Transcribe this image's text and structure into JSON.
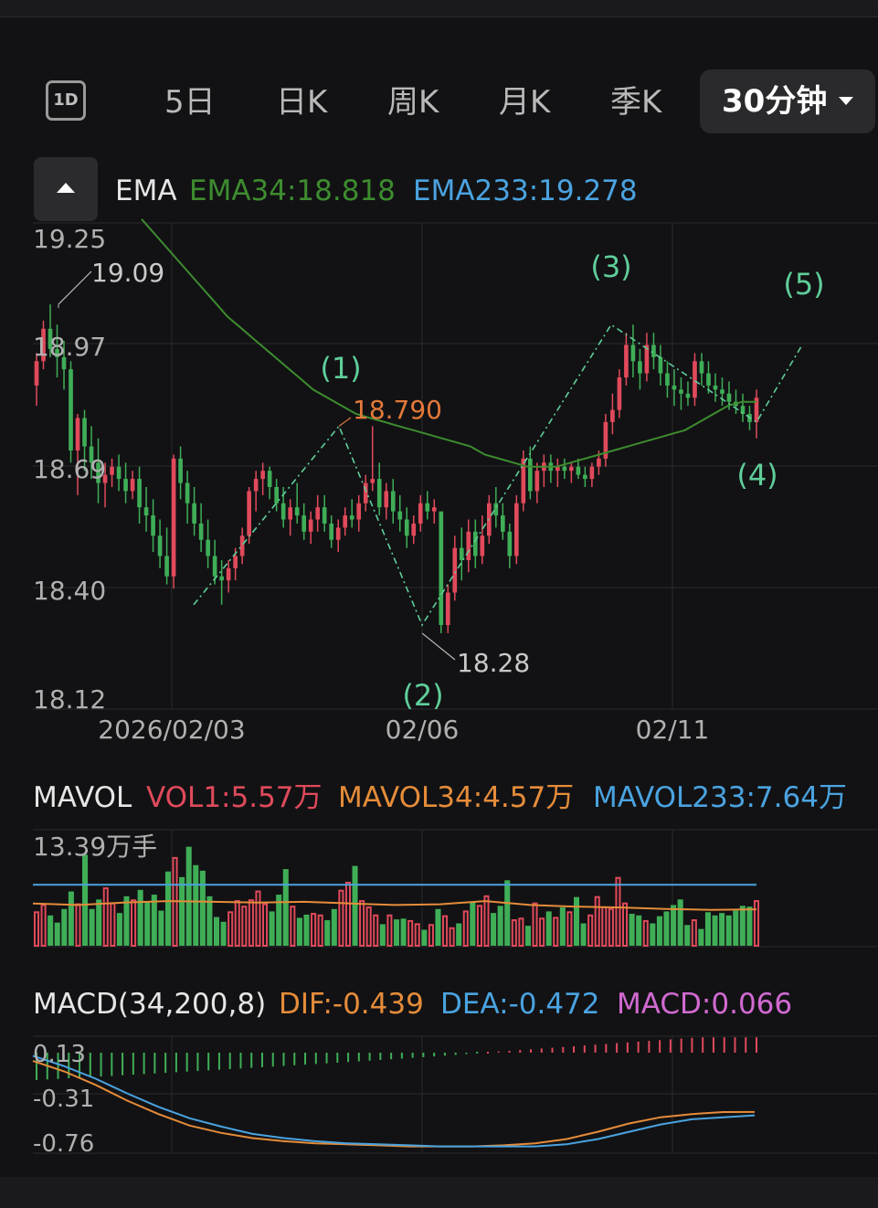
{
  "tabs": [
    {
      "label": "1D"
    },
    {
      "label": "5日"
    },
    {
      "label": "日K"
    },
    {
      "label": "周K"
    },
    {
      "label": "月K"
    },
    {
      "label": "季K"
    }
  ],
  "active_tab": {
    "label": "30分钟"
  },
  "ema_legend": {
    "name": "EMA",
    "ema34": "EMA34:18.818",
    "ema233": "EMA233:19.278"
  },
  "vol_legend": {
    "name": "MAVOL",
    "vol1": "VOL1:5.57万",
    "mavol34": "MAVOL34:4.57万",
    "mavol233": "MAVOL233:7.64万"
  },
  "macd_legend": {
    "name": "MACD(34,200,8)",
    "dif": "DIF:-0.439",
    "dea": "DEA:-0.472",
    "macd": "MACD:0.066"
  },
  "colors": {
    "up": "#e04a5b",
    "down": "#3fae57",
    "ema34": "#3d8c2f",
    "ema233": "#4aa3e0",
    "wave": "#5fcf9a",
    "high_label": "#e3793a",
    "mavol34": "#e58c3a",
    "mavol233": "#4aa3e0",
    "macd_hist": "#d26ad2"
  },
  "chart_data": [
    {
      "type": "candlestick",
      "ylim": [
        18.12,
        19.25
      ],
      "y_ticks": [
        "19.25",
        "18.97",
        "18.69",
        "18.40",
        "18.12"
      ],
      "x_ticks": [
        "2026/02/03",
        "02/06",
        "02/11"
      ],
      "ohlc": [
        [
          18.89,
          18.97,
          18.84,
          18.95
        ],
        [
          18.95,
          19.05,
          18.93,
          19.03
        ],
        [
          19.03,
          19.09,
          18.96,
          18.98
        ],
        [
          18.98,
          19.04,
          18.91,
          18.96
        ],
        [
          18.96,
          19.0,
          18.88,
          18.93
        ],
        [
          18.93,
          18.95,
          18.7,
          18.73
        ],
        [
          18.73,
          18.82,
          18.62,
          18.81
        ],
        [
          18.81,
          18.83,
          18.68,
          18.74
        ],
        [
          18.74,
          18.79,
          18.66,
          18.7
        ],
        [
          18.7,
          18.76,
          18.6,
          18.65
        ],
        [
          18.65,
          18.7,
          18.59,
          18.67
        ],
        [
          18.67,
          18.71,
          18.64,
          18.69
        ],
        [
          18.69,
          18.72,
          18.63,
          18.66
        ],
        [
          18.66,
          18.7,
          18.6,
          18.63
        ],
        [
          18.63,
          18.68,
          18.61,
          18.66
        ],
        [
          18.66,
          18.69,
          18.55,
          18.59
        ],
        [
          18.59,
          18.64,
          18.53,
          18.57
        ],
        [
          18.57,
          18.61,
          18.48,
          18.52
        ],
        [
          18.52,
          18.56,
          18.44,
          18.47
        ],
        [
          18.47,
          18.54,
          18.4,
          18.42
        ],
        [
          18.42,
          18.72,
          18.39,
          18.71
        ],
        [
          18.71,
          18.74,
          18.61,
          18.65
        ],
        [
          18.65,
          18.68,
          18.55,
          18.6
        ],
        [
          18.6,
          18.64,
          18.52,
          18.55
        ],
        [
          18.55,
          18.6,
          18.48,
          18.51
        ],
        [
          18.51,
          18.56,
          18.44,
          18.47
        ],
        [
          18.47,
          18.51,
          18.4,
          18.42
        ],
        [
          18.42,
          18.46,
          18.35,
          18.41
        ],
        [
          18.41,
          18.46,
          18.38,
          18.44
        ],
        [
          18.44,
          18.49,
          18.41,
          18.47
        ],
        [
          18.47,
          18.54,
          18.45,
          18.52
        ],
        [
          18.52,
          18.64,
          18.5,
          18.63
        ],
        [
          18.63,
          18.68,
          18.58,
          18.66
        ],
        [
          18.66,
          18.7,
          18.62,
          18.68
        ],
        [
          18.68,
          18.69,
          18.61,
          18.64
        ],
        [
          18.64,
          18.66,
          18.58,
          18.6
        ],
        [
          18.6,
          18.64,
          18.54,
          18.56
        ],
        [
          18.56,
          18.61,
          18.52,
          18.59
        ],
        [
          18.59,
          18.65,
          18.55,
          18.57
        ],
        [
          18.57,
          18.6,
          18.51,
          18.53
        ],
        [
          18.53,
          18.58,
          18.5,
          18.56
        ],
        [
          18.56,
          18.62,
          18.53,
          18.59
        ],
        [
          18.59,
          18.62,
          18.53,
          18.55
        ],
        [
          18.55,
          18.57,
          18.49,
          18.51
        ],
        [
          18.51,
          18.56,
          18.48,
          18.54
        ],
        [
          18.54,
          18.59,
          18.52,
          18.57
        ],
        [
          18.57,
          18.61,
          18.54,
          18.56
        ],
        [
          18.56,
          18.62,
          18.53,
          18.6
        ],
        [
          18.6,
          18.67,
          18.58,
          18.65
        ],
        [
          18.65,
          18.79,
          18.63,
          18.66
        ],
        [
          18.66,
          18.7,
          18.57,
          18.59
        ],
        [
          18.59,
          18.65,
          18.56,
          18.63
        ],
        [
          18.63,
          18.66,
          18.55,
          18.58
        ],
        [
          18.58,
          18.62,
          18.53,
          18.56
        ],
        [
          18.56,
          18.59,
          18.49,
          18.52
        ],
        [
          18.52,
          18.57,
          18.5,
          18.55
        ],
        [
          18.55,
          18.62,
          18.53,
          18.6
        ],
        [
          18.6,
          18.63,
          18.56,
          18.58
        ],
        [
          18.58,
          18.61,
          18.55,
          18.59
        ],
        [
          18.58,
          18.56,
          18.28,
          18.3
        ],
        [
          18.3,
          18.4,
          18.28,
          18.38
        ],
        [
          18.38,
          18.52,
          18.36,
          18.49
        ],
        [
          18.49,
          18.54,
          18.41,
          18.46
        ],
        [
          18.46,
          18.56,
          18.43,
          18.53
        ],
        [
          18.53,
          18.56,
          18.44,
          18.47
        ],
        [
          18.47,
          18.57,
          18.45,
          18.52
        ],
        [
          18.52,
          18.62,
          18.5,
          18.6
        ],
        [
          18.6,
          18.64,
          18.54,
          18.57
        ],
        [
          18.57,
          18.6,
          18.51,
          18.53
        ],
        [
          18.53,
          18.55,
          18.44,
          18.47
        ],
        [
          18.47,
          18.62,
          18.45,
          18.6
        ],
        [
          18.6,
          18.73,
          18.58,
          18.71
        ],
        [
          18.71,
          18.74,
          18.61,
          18.63
        ],
        [
          18.63,
          18.7,
          18.6,
          18.68
        ],
        [
          18.68,
          18.72,
          18.64,
          18.7
        ],
        [
          18.7,
          18.72,
          18.65,
          18.68
        ],
        [
          18.68,
          18.71,
          18.64,
          18.69
        ],
        [
          18.69,
          18.71,
          18.66,
          18.68
        ],
        [
          18.68,
          18.7,
          18.65,
          18.69
        ],
        [
          18.69,
          18.71,
          18.66,
          18.67
        ],
        [
          18.67,
          18.69,
          18.64,
          18.66
        ],
        [
          18.66,
          18.7,
          18.64,
          18.69
        ],
        [
          18.69,
          18.73,
          18.67,
          18.71
        ],
        [
          18.71,
          18.82,
          18.69,
          18.8
        ],
        [
          18.8,
          18.87,
          18.77,
          18.83
        ],
        [
          18.83,
          18.93,
          18.81,
          18.91
        ],
        [
          18.91,
          19.02,
          18.89,
          18.99
        ],
        [
          18.99,
          19.04,
          18.91,
          18.95
        ],
        [
          18.95,
          18.98,
          18.88,
          18.92
        ],
        [
          18.92,
          19.02,
          18.9,
          18.99
        ],
        [
          18.99,
          19.02,
          18.93,
          18.96
        ],
        [
          18.96,
          18.99,
          18.89,
          18.92
        ],
        [
          18.92,
          18.95,
          18.86,
          18.89
        ],
        [
          18.89,
          18.93,
          18.84,
          18.88
        ],
        [
          18.88,
          18.91,
          18.83,
          18.87
        ],
        [
          18.87,
          18.9,
          18.84,
          18.86
        ],
        [
          18.86,
          18.97,
          18.84,
          18.95
        ],
        [
          18.95,
          18.97,
          18.89,
          18.92
        ],
        [
          18.92,
          18.95,
          18.87,
          18.89
        ],
        [
          18.89,
          18.92,
          18.85,
          18.88
        ],
        [
          18.88,
          18.91,
          18.84,
          18.87
        ],
        [
          18.87,
          18.9,
          18.83,
          18.85
        ],
        [
          18.85,
          18.88,
          18.82,
          18.84
        ],
        [
          18.84,
          18.87,
          18.8,
          18.82
        ],
        [
          18.82,
          18.84,
          18.78,
          18.8
        ],
        [
          18.8,
          18.88,
          18.76,
          18.86
        ]
      ],
      "ema34": [
        19.3,
        19.26,
        19.22,
        19.18,
        19.14,
        19.1,
        19.06,
        19.03,
        19.0,
        18.97,
        18.94,
        18.91,
        18.88,
        18.86,
        18.84,
        18.82,
        18.81,
        18.8,
        18.79,
        18.78,
        18.77,
        18.76,
        18.75,
        18.74,
        18.72,
        18.71,
        18.7,
        18.69,
        18.69,
        18.69,
        18.7,
        18.71,
        18.72,
        18.73,
        18.74,
        18.75,
        18.76,
        18.77,
        18.78,
        18.8,
        18.82,
        18.84,
        18.85,
        18.85
      ],
      "annotations": [
        {
          "text": "19.09",
          "value": 19.09,
          "kind": "high"
        },
        {
          "text": "18.790",
          "value": 18.79,
          "kind": "wave-high"
        },
        {
          "text": "18.28",
          "value": 18.28,
          "kind": "low"
        }
      ],
      "wave_labels": [
        "(1)",
        "(2)",
        "(3)",
        "(4)",
        "(5)"
      ],
      "wave_points": [
        18.35,
        18.79,
        18.3,
        19.04,
        18.8,
        18.99
      ]
    },
    {
      "type": "bar",
      "title": "MAVOL",
      "ymax_label": "13.39万手",
      "volumes": [
        4.2,
        5.1,
        3.8,
        2.9,
        4.6,
        6.8,
        5.2,
        11.4,
        4.6,
        5.8,
        7.2,
        5.3,
        4.1,
        6.2,
        5.7,
        7.0,
        5.6,
        6.4,
        4.4,
        9.3,
        11.0,
        8.6,
        12.4,
        10.1,
        9.4,
        6.2,
        3.6,
        3.0,
        4.2,
        5.6,
        4.9,
        5.7,
        6.8,
        5.2,
        4.3,
        6.4,
        9.6,
        4.9,
        3.5,
        3.9,
        4.0,
        3.8,
        3.2,
        4.6,
        6.9,
        7.9,
        10.0,
        5.6,
        4.8,
        3.8,
        2.7,
        3.8,
        3.3,
        3.4,
        3.1,
        2.7,
        2.0,
        2.6,
        4.6,
        3.7,
        2.2,
        2.8,
        4.3,
        5.5,
        5.0,
        6.2,
        4.1,
        5.0,
        8.2,
        3.2,
        3.4,
        2.5,
        5.3,
        3.4,
        4.3,
        3.5,
        4.8,
        4.2,
        6.1,
        2.8,
        3.8,
        6.1,
        4.8,
        4.6,
        8.5,
        5.3,
        4.0,
        3.8,
        3.1,
        2.8,
        3.7,
        4.3,
        5.1,
        5.8,
        2.6,
        3.2,
        2.1,
        4.2,
        3.8,
        4.1,
        3.8,
        4.4,
        5.0,
        4.9,
        5.6
      ],
      "mavol34": [
        5.3,
        5.1,
        5.4,
        5.6,
        5.5,
        5.4,
        5.5,
        5.3,
        5.1,
        5.2,
        5.6,
        5.1,
        4.9,
        4.8,
        4.6,
        4.5,
        4.57
      ],
      "mavol233": [
        7.64,
        7.64,
        7.64,
        7.64,
        7.64
      ]
    },
    {
      "type": "line",
      "title": "MACD(34,200,8)",
      "y_ticks": [
        "0.13",
        "-0.31",
        "-0.76"
      ],
      "ylim": [
        -0.8,
        0.13
      ],
      "dif": [
        0.05,
        -0.05,
        -0.18,
        -0.33,
        -0.46,
        -0.57,
        -0.64,
        -0.69,
        -0.72,
        -0.74,
        -0.75,
        -0.76,
        -0.77,
        -0.77,
        -0.77,
        -0.76,
        -0.74,
        -0.7,
        -0.63,
        -0.55,
        -0.49,
        -0.46,
        -0.44,
        -0.439
      ],
      "dea": [
        0.1,
        0.0,
        -0.12,
        -0.26,
        -0.39,
        -0.5,
        -0.58,
        -0.65,
        -0.69,
        -0.72,
        -0.74,
        -0.75,
        -0.76,
        -0.77,
        -0.77,
        -0.77,
        -0.77,
        -0.75,
        -0.7,
        -0.63,
        -0.56,
        -0.51,
        -0.49,
        -0.472
      ]
    }
  ]
}
